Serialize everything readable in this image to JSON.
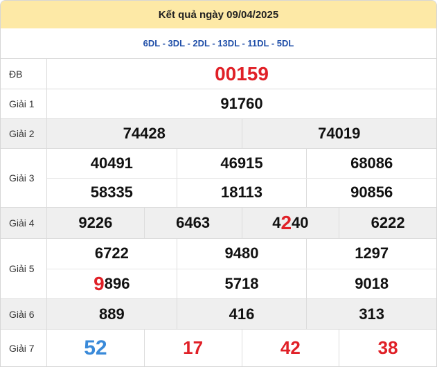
{
  "header": {
    "title": "Kết quả ngày 09/04/2025"
  },
  "subheader": {
    "provinces": "6DL - 3DL - 2DL - 13DL - 11DL - 5DL"
  },
  "prizes": {
    "db": {
      "label": "ĐB",
      "value": "00159"
    },
    "g1": {
      "label": "Giải 1",
      "values": [
        "91760"
      ]
    },
    "g2": {
      "label": "Giải 2",
      "values": [
        "74428",
        "74019"
      ]
    },
    "g3": {
      "label": "Giải 3",
      "values": [
        "40491",
        "46915",
        "68086",
        "58335",
        "18113",
        "90856"
      ]
    },
    "g4": {
      "label": "Giải 4",
      "values": [
        "9226",
        "6463",
        "4240",
        "6222"
      ]
    },
    "g5": {
      "label": "Giải 5",
      "values": [
        "6722",
        "9480",
        "1297",
        "9896",
        "5718",
        "9018"
      ]
    },
    "g6": {
      "label": "Giải 6",
      "values": [
        "889",
        "416",
        "313"
      ]
    },
    "g7": {
      "label": "Giải 7",
      "values": [
        "52",
        "17",
        "42",
        "38"
      ]
    }
  },
  "colors": {
    "accent_red": "#e02027",
    "accent_blue": "#3a8ad9",
    "header_bg": "#fde9a6",
    "subheader_text": "#1f4ea8"
  }
}
